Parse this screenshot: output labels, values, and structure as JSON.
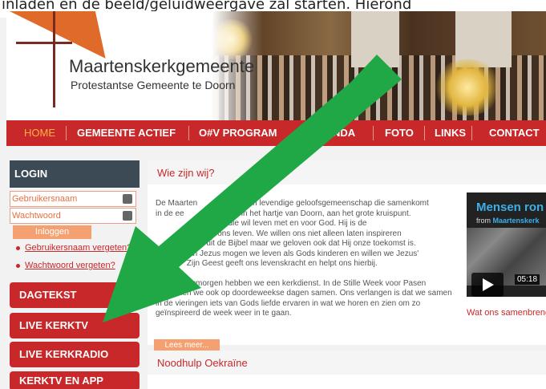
{
  "caption": {
    "text": "inladen en de beeld/geluidweergave zal starten. Hierond"
  },
  "header": {
    "logo_title": "Maartenskerkgemeente",
    "logo_subtitle": "Protestantse Gemeente te Doorn"
  },
  "nav": {
    "items": [
      {
        "label": "HOME",
        "active": true
      },
      {
        "label": "GEMEENTE ACTIEF"
      },
      {
        "label": "O#V PROGRAM"
      },
      {
        "label": "NDA"
      },
      {
        "label": "FOTO"
      },
      {
        "label": "LINKS"
      },
      {
        "label": "CONTACT"
      }
    ]
  },
  "login": {
    "title": "LOGIN",
    "username_placeholder": "Gebruikersnaam",
    "password_placeholder": "Wachtwoord",
    "button": "Inloggen",
    "forgot_username": "Gebruikersnaam vergeten?",
    "forgot_password": "Wachtwoord vergeten?"
  },
  "sidebar_menu": [
    {
      "label": "DAGTEKST"
    },
    {
      "label": "LIVE KERKTV"
    },
    {
      "label": "LIVE KERKRADIO"
    },
    {
      "label": "KERKTV EN APP"
    }
  ],
  "main": {
    "title": "Wie zijn wij?",
    "lines": [
      "De Maarten                  s een levendige geloofsgemeenschap die samenkomt",
      "in de ee            enskerk in het hartje van Doorn, aan het grote kruispunt.",
      "                eenschap die wil leven met en voor God. Hij is de",
      "               Zin van ons leven. We willen ons niet alleen laten inspireren",
      "             halen uit de Bijbel maar we geloven ook dat Hij onze toekomst is.",
      "             van Jezus mogen we leven als Gods kinderen en willen we Jezus'",
      "              Zijn Geest geeft ons levenskracht en helpt ons hierbij.",
      "",
      "          ndagmorgen hebben we een kerkdienst. In de Stille Week voor Pasen",
      "       amen we ook op doordeweekse dagen samen. Ons verlangen is dat we samen",
      "in de vieringen iets van Gods liefde ervaren in wat we horen en zien om zo",
      "geïnspireerd de week weer in te gaan."
    ],
    "read_more": "Lees meer..."
  },
  "video": {
    "title": "Mensen ron",
    "from_prefix": "from ",
    "from_channel": "Maartenskerk",
    "duration": "05:18",
    "caption": "Wat ons samenbreng"
  },
  "news": {
    "title": "Noodhulp Oekraïne"
  },
  "colors": {
    "brand_red": "#c8282a",
    "accent_orange": "#f4a070",
    "login_dark": "#3c4a55",
    "arrow_green": "#1fa845"
  }
}
